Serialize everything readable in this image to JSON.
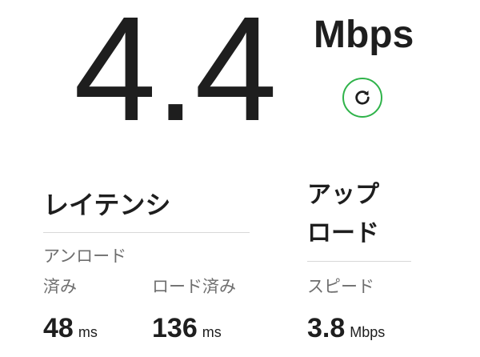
{
  "download": {
    "speed": "4.4",
    "unit": "Mbps"
  },
  "restart_icon": "refresh-icon",
  "accent_color": "#2fb34a",
  "latency": {
    "title": "レイテンシ",
    "unloaded_label": "アンロード",
    "unloaded_sub_label": "済み",
    "loaded_label": "ロード済み",
    "unloaded_value": "48",
    "unloaded_unit": "ms",
    "loaded_value": "136",
    "loaded_unit": "ms"
  },
  "upload": {
    "title_line1": "アップ",
    "title_line2": "ロード",
    "speed_label": "スピード",
    "value": "3.8",
    "unit": "Mbps"
  }
}
